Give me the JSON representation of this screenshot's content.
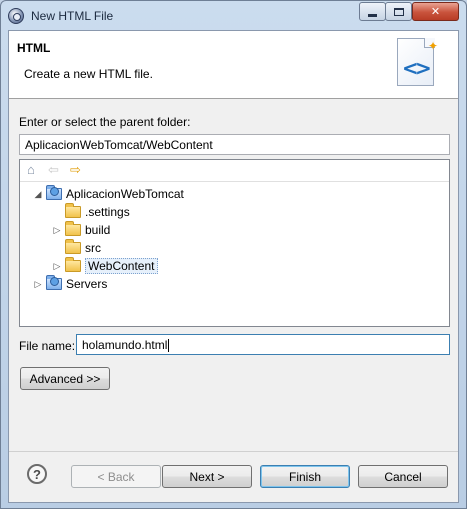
{
  "window": {
    "title": "New HTML File",
    "controls": {
      "minimize": "minimize-icon",
      "maximize": "maximize-icon",
      "close": "✕"
    }
  },
  "header": {
    "title": "HTML",
    "description": "Create a new HTML file.",
    "icon": "html-file-wizard-icon"
  },
  "parent_folder": {
    "label": "Enter or select the parent folder:",
    "value": "AplicacionWebTomcat/WebContent"
  },
  "tree_toolbar": {
    "home": "home-icon",
    "back": "back-arrow-icon",
    "forward": "forward-arrow-icon"
  },
  "tree": {
    "items": [
      {
        "label": "AplicacionWebTomcat",
        "level": 1,
        "expanded": true,
        "type": "project"
      },
      {
        "label": ".settings",
        "level": 2,
        "expandable": false,
        "type": "folder"
      },
      {
        "label": "build",
        "level": 2,
        "expandable": true,
        "type": "folder"
      },
      {
        "label": "src",
        "level": 2,
        "expandable": false,
        "type": "folder"
      },
      {
        "label": "WebContent",
        "level": 2,
        "expandable": true,
        "type": "folder",
        "selected": true
      },
      {
        "label": "Servers",
        "level": 1,
        "expandable": true,
        "type": "folder"
      }
    ]
  },
  "file_name": {
    "label": "File name:",
    "value": "holamundo.html"
  },
  "buttons": {
    "advanced": "Advanced >>",
    "back": "< Back",
    "next": "Next >",
    "finish": "Finish",
    "cancel": "Cancel",
    "help": "?"
  }
}
